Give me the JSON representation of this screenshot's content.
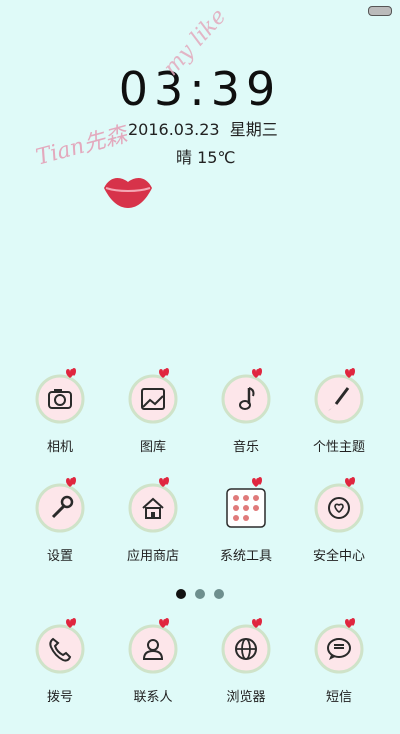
{
  "status": {
    "battery_icon": "battery-icon"
  },
  "lockscreen": {
    "time": "03:39",
    "date": "2016.03.23",
    "weekday": "星期三",
    "weather": "晴",
    "temperature": "15℃",
    "signature_name": "Tian先森",
    "signature_text": "my like"
  },
  "apps": [
    {
      "label": "相机",
      "icon": "camera-icon"
    },
    {
      "label": "图库",
      "icon": "gallery-icon"
    },
    {
      "label": "音乐",
      "icon": "music-note-icon"
    },
    {
      "label": "个性主题",
      "icon": "paintbrush-icon"
    },
    {
      "label": "设置",
      "icon": "wrench-icon"
    },
    {
      "label": "应用商店",
      "icon": "store-house-icon"
    },
    {
      "label": "系统工具",
      "icon": "system-tools-folder-icon"
    },
    {
      "label": "安全中心",
      "icon": "shield-heart-icon"
    }
  ],
  "pager": {
    "count": 3,
    "active": 0
  },
  "dock": [
    {
      "label": "拨号",
      "icon": "phone-icon"
    },
    {
      "label": "联系人",
      "icon": "contact-icon"
    },
    {
      "label": "浏览器",
      "icon": "globe-icon"
    },
    {
      "label": "短信",
      "icon": "message-icon"
    }
  ],
  "colors": {
    "background": "#dffaf8",
    "badge_fill": "#fde6ea",
    "badge_border": "#cfe3c9",
    "heart": "#e0263f"
  }
}
